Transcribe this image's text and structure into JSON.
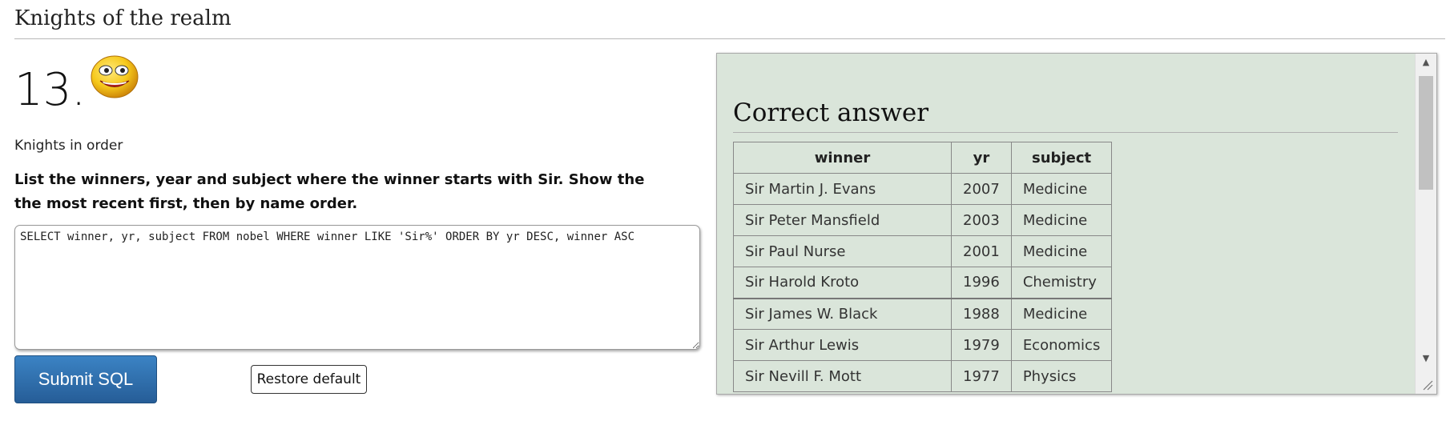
{
  "page": {
    "section_title": "Knights of the realm"
  },
  "question": {
    "number": "13.",
    "subheading": "Knights in order",
    "instructions": "List the winners, year and subject where the winner starts with Sir. Show the the most recent first, then by name order.",
    "sql": "SELECT winner, yr, subject FROM nobel WHERE winner LIKE 'Sir%' ORDER BY yr DESC, winner ASC"
  },
  "buttons": {
    "submit_label": "Submit SQL",
    "restore_label": "Restore default"
  },
  "answer": {
    "title": "Correct answer",
    "columns": [
      "winner",
      "yr",
      "subject"
    ],
    "rows": [
      [
        "Sir Martin J. Evans",
        "2007",
        "Medicine"
      ],
      [
        "Sir Peter Mansfield",
        "2003",
        "Medicine"
      ],
      [
        "Sir Paul Nurse",
        "2001",
        "Medicine"
      ],
      [
        "Sir Harold Kroto",
        "1996",
        "Chemistry"
      ],
      [
        "Sir James W. Black",
        "1988",
        "Medicine"
      ],
      [
        "Sir Arthur Lewis",
        "1979",
        "Economics"
      ],
      [
        "Sir Nevill F. Mott",
        "1977",
        "Physics"
      ]
    ]
  },
  "icons": {
    "smiley": "smiley-face-icon",
    "scroll_up": "scroll-up-arrow-icon",
    "scroll_down": "scroll-down-arrow-icon",
    "resize": "resize-grip-icon"
  },
  "colors": {
    "panel_bg": "#dae5da",
    "submit_bg": "#2f6fab",
    "smiley_yellow": "#f6c91c"
  }
}
